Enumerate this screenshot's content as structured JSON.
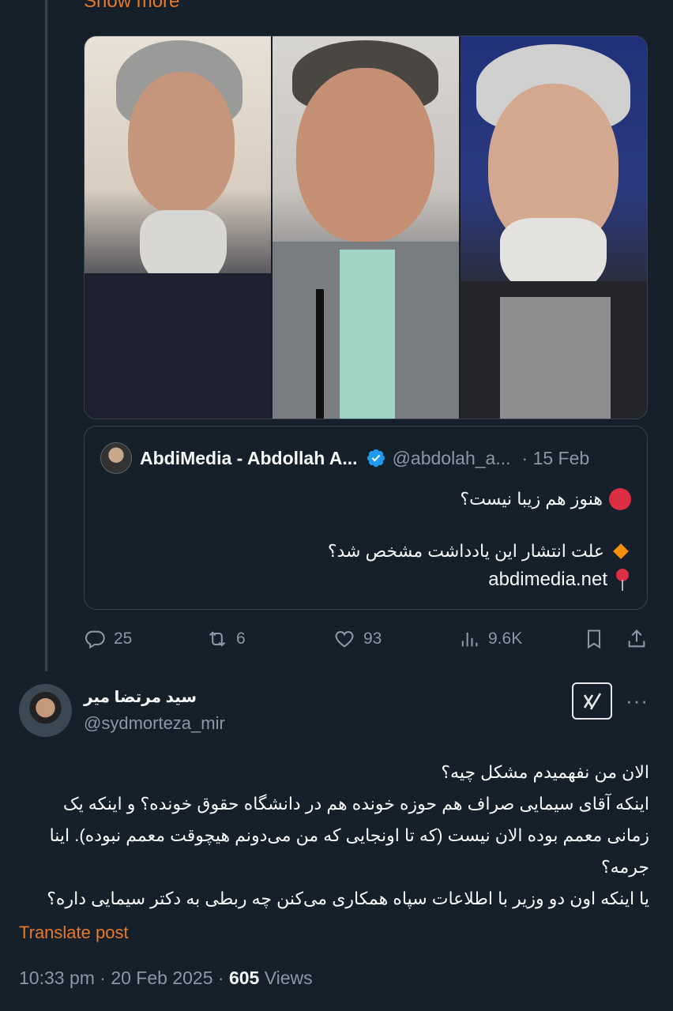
{
  "previous_post": {
    "show_more_label": "Show more",
    "quote": {
      "author_name": "AbdiMedia - Abdollah A...",
      "author_handle": "@abdolah_a...",
      "date": "· 15 Feb",
      "line1": "هنوز هم زیبا نیست؟",
      "line2": "علت انتشار این یادداشت مشخص شد؟",
      "link": "abdimedia.net"
    },
    "actions": {
      "replies": "25",
      "reposts": "6",
      "likes": "93",
      "views": "9.6K"
    }
  },
  "reply_post": {
    "author_name": "سید مرتضا میر",
    "author_handle": "@sydmorteza_mir",
    "text_lines": [
      "الان من نفهمیدم مشکل چیه؟",
      "اینکه آقای سیمایی صراف هم حوزه خونده هم در دانشگاه حقوق خونده؟ و اینکه یک",
      "زمانی معمم بوده الان نیست (که تا اونجایی که من می‌دونم هیچوقت معمم نبوده). اینا",
      "جرمه؟",
      "یا اینکه اون دو وزیر با اطلاعات سپاه همکاری می‌کنن چه ربطی به دکتر سیمایی داره؟"
    ],
    "translate_label": "Translate post",
    "time": "10:33 pm · 20 Feb 2025 · ",
    "views_count": "605",
    "views_label": " Views"
  },
  "colors": {
    "background": "#15202b",
    "accent_orange": "#e8792a",
    "muted": "#8b98a5",
    "border": "#38444d",
    "verified_blue": "#1d9bf0"
  },
  "icons": [
    "reply-icon",
    "repost-icon",
    "like-icon",
    "views-icon",
    "bookmark-icon",
    "share-icon",
    "grok-icon",
    "more-icon",
    "verified-icon"
  ]
}
